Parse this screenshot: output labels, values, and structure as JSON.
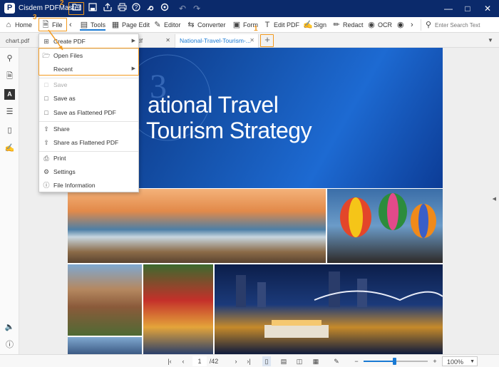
{
  "app": {
    "title": "Cisdem PDFMaster",
    "logo": "P"
  },
  "annotations": [
    "1",
    "2",
    "3"
  ],
  "toolbar": {
    "home": "Home",
    "file": "File",
    "tools": "Tools",
    "page_edit": "Page Edit",
    "editor": "Editor",
    "converter": "Converter",
    "form": "Form",
    "edit_pdf": "Edit PDF",
    "sign": "Sign",
    "redact": "Redact",
    "ocr": "OCR",
    "search_placeholder": "Enter Search Text"
  },
  "tabs": [
    {
      "label": "chart.pdf"
    },
    {
      "label": "df"
    },
    {
      "label": "National-Travel-Tourism-..."
    }
  ],
  "menu": {
    "create_pdf": "Create PDF",
    "open_files": "Open Files",
    "recent": "Recent",
    "save": "Save",
    "save_as": "Save as",
    "save_flattened": "Save as Flattened PDF",
    "share": "Share",
    "share_flattened": "Share as Flattened PDF",
    "print": "Print",
    "settings": "Settings",
    "file_info": "File Information"
  },
  "document": {
    "title_line1": "ational Travel",
    "title_line2": "Tourism Strategy"
  },
  "status": {
    "current_page": "1",
    "total_pages": "/42",
    "zoom": "100%"
  },
  "colors": {
    "titlebar": "#0b2a6b",
    "accent": "#f39a1e",
    "link": "#1a7ad4"
  }
}
